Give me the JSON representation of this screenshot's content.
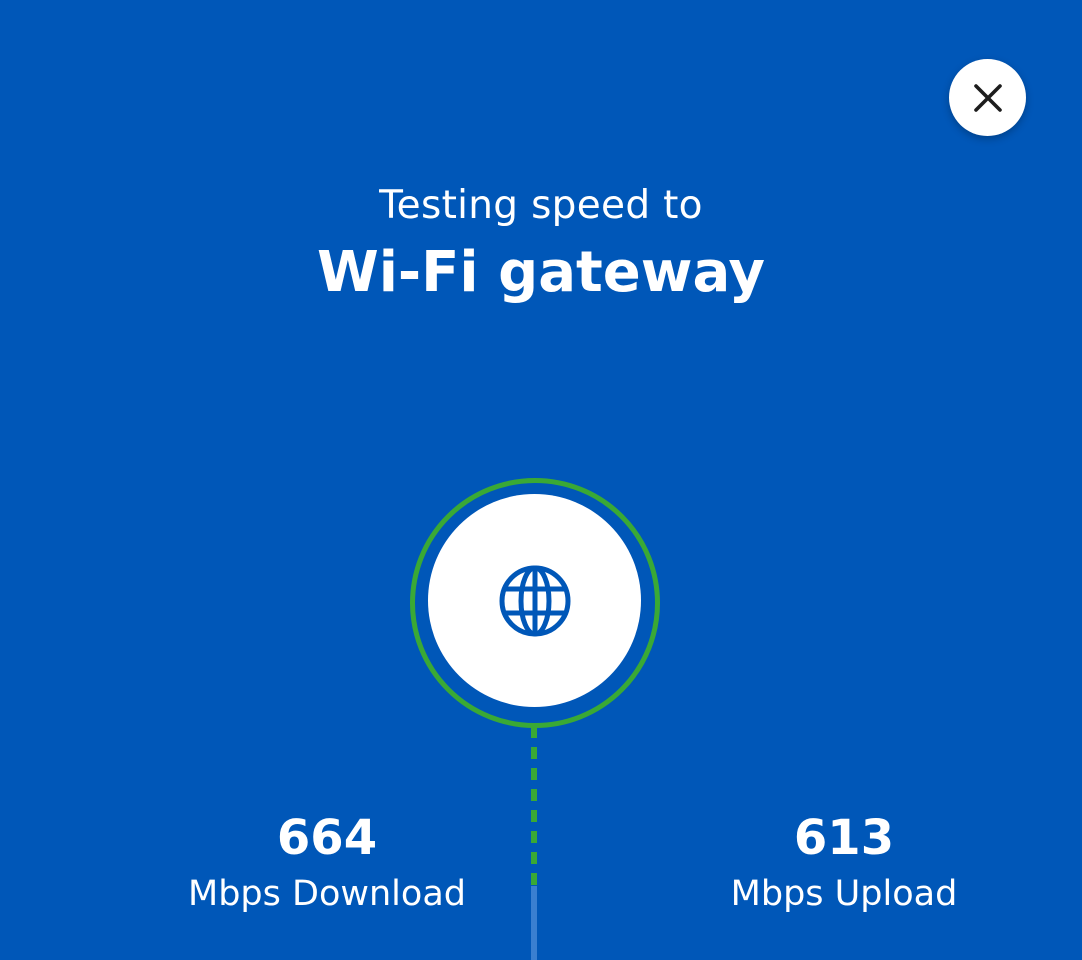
{
  "header": {
    "subtitle": "Testing speed to",
    "title": "Wi-Fi gateway"
  },
  "node": {
    "icon": "globe-icon",
    "ring_color": "#3aa935",
    "fill_color": "#ffffff"
  },
  "close_button": {
    "icon": "close-icon"
  },
  "results": {
    "download": {
      "value": "664",
      "label": "Mbps Download"
    },
    "upload": {
      "value": "613",
      "label": "Mbps Upload"
    }
  },
  "colors": {
    "background": "#0057b8",
    "accent_green": "#3aa935",
    "icon_blue": "#0057b8"
  }
}
